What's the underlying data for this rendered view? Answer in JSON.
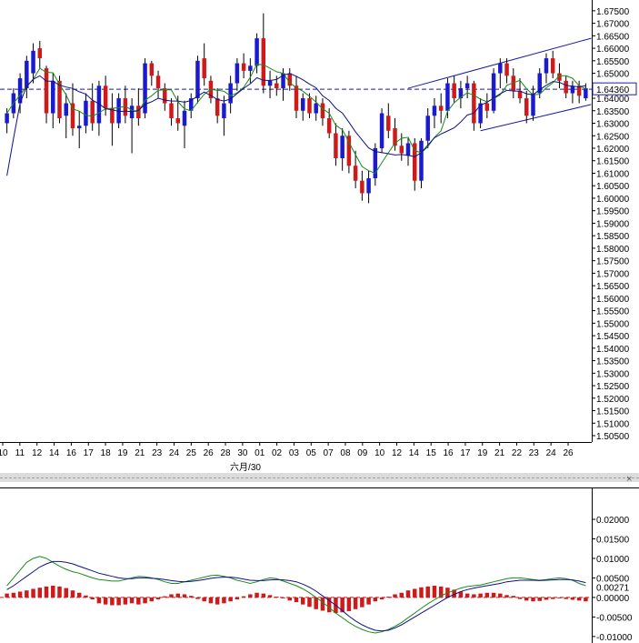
{
  "chart_data": [
    {
      "type": "candlestick",
      "title": "",
      "ylim": [
        1.505,
        1.6775
      ],
      "y_ticks": [
        "1.67500",
        "1.67000",
        "1.66500",
        "1.66000",
        "1.65500",
        "1.65000",
        "1.64500",
        "1.64000",
        "1.63500",
        "1.63000",
        "1.62500",
        "1.62000",
        "1.61500",
        "1.61000",
        "1.60500",
        "1.60000",
        "1.59500",
        "1.59000",
        "1.58500",
        "1.58000",
        "1.57500",
        "1.57000",
        "1.56500",
        "1.56000",
        "1.55500",
        "1.55000",
        "1.54500",
        "1.54000",
        "1.53500",
        "1.53000",
        "1.52500",
        "1.52000",
        "1.51500",
        "1.51000",
        "1.50500"
      ],
      "current_price_label": "1.64360",
      "current_price": 1.6436,
      "x_labels": [
        "10",
        "11",
        "12",
        "14",
        "16",
        "17",
        "18",
        "19",
        "21",
        "23",
        "24",
        "25",
        "26",
        "28",
        "30",
        "01",
        "02",
        "03",
        "05",
        "07",
        "08",
        "09",
        "10",
        "12",
        "14",
        "15",
        "16",
        "17",
        "19",
        "21",
        "22",
        "23",
        "24",
        "26"
      ],
      "x_label_month": "六月/30",
      "colors": {
        "up": "#1a1ad0",
        "down": "#d01a1a",
        "ma_fast": "#1a8a1a",
        "ma_slow": "#10108a",
        "channel": "#1a1aa8",
        "price_line": "#1a1aa8"
      },
      "candles": [
        {
          "o": 1.63,
          "h": 1.636,
          "l": 1.626,
          "c": 1.634
        },
        {
          "o": 1.634,
          "h": 1.644,
          "l": 1.632,
          "c": 1.642
        },
        {
          "o": 1.638,
          "h": 1.65,
          "l": 1.634,
          "c": 1.648
        },
        {
          "o": 1.644,
          "h": 1.657,
          "l": 1.64,
          "c": 1.655
        },
        {
          "o": 1.65,
          "h": 1.662,
          "l": 1.646,
          "c": 1.659
        },
        {
          "o": 1.66,
          "h": 1.663,
          "l": 1.652,
          "c": 1.656
        },
        {
          "o": 1.652,
          "h": 1.653,
          "l": 1.63,
          "c": 1.634
        },
        {
          "o": 1.634,
          "h": 1.65,
          "l": 1.628,
          "c": 1.647
        },
        {
          "o": 1.647,
          "h": 1.649,
          "l": 1.63,
          "c": 1.632
        },
        {
          "o": 1.633,
          "h": 1.642,
          "l": 1.624,
          "c": 1.638
        },
        {
          "o": 1.638,
          "h": 1.646,
          "l": 1.625,
          "c": 1.628
        },
        {
          "o": 1.628,
          "h": 1.635,
          "l": 1.62,
          "c": 1.629
        },
        {
          "o": 1.629,
          "h": 1.642,
          "l": 1.626,
          "c": 1.639
        },
        {
          "o": 1.639,
          "h": 1.646,
          "l": 1.627,
          "c": 1.63
        },
        {
          "o": 1.63,
          "h": 1.647,
          "l": 1.625,
          "c": 1.645
        },
        {
          "o": 1.645,
          "h": 1.649,
          "l": 1.633,
          "c": 1.636
        },
        {
          "o": 1.636,
          "h": 1.642,
          "l": 1.621,
          "c": 1.63
        },
        {
          "o": 1.63,
          "h": 1.642,
          "l": 1.628,
          "c": 1.64
        },
        {
          "o": 1.64,
          "h": 1.645,
          "l": 1.63,
          "c": 1.633
        },
        {
          "o": 1.632,
          "h": 1.64,
          "l": 1.618,
          "c": 1.637
        },
        {
          "o": 1.637,
          "h": 1.644,
          "l": 1.629,
          "c": 1.632
        },
        {
          "o": 1.634,
          "h": 1.656,
          "l": 1.632,
          "c": 1.654
        },
        {
          "o": 1.654,
          "h": 1.655,
          "l": 1.645,
          "c": 1.649
        },
        {
          "o": 1.649,
          "h": 1.651,
          "l": 1.64,
          "c": 1.644
        },
        {
          "o": 1.644,
          "h": 1.646,
          "l": 1.635,
          "c": 1.638
        },
        {
          "o": 1.638,
          "h": 1.64,
          "l": 1.629,
          "c": 1.632
        },
        {
          "o": 1.632,
          "h": 1.641,
          "l": 1.627,
          "c": 1.63
        },
        {
          "o": 1.629,
          "h": 1.639,
          "l": 1.62,
          "c": 1.635
        },
        {
          "o": 1.635,
          "h": 1.642,
          "l": 1.632,
          "c": 1.64
        },
        {
          "o": 1.64,
          "h": 1.657,
          "l": 1.638,
          "c": 1.655
        },
        {
          "o": 1.656,
          "h": 1.662,
          "l": 1.645,
          "c": 1.648
        },
        {
          "o": 1.647,
          "h": 1.649,
          "l": 1.638,
          "c": 1.64
        },
        {
          "o": 1.64,
          "h": 1.644,
          "l": 1.63,
          "c": 1.633
        },
        {
          "o": 1.632,
          "h": 1.641,
          "l": 1.625,
          "c": 1.638
        },
        {
          "o": 1.638,
          "h": 1.649,
          "l": 1.634,
          "c": 1.646
        },
        {
          "o": 1.646,
          "h": 1.656,
          "l": 1.643,
          "c": 1.654
        },
        {
          "o": 1.654,
          "h": 1.658,
          "l": 1.648,
          "c": 1.651
        },
        {
          "o": 1.651,
          "h": 1.656,
          "l": 1.646,
          "c": 1.653
        },
        {
          "o": 1.653,
          "h": 1.666,
          "l": 1.65,
          "c": 1.664
        },
        {
          "o": 1.664,
          "h": 1.674,
          "l": 1.642,
          "c": 1.645
        },
        {
          "o": 1.645,
          "h": 1.651,
          "l": 1.64,
          "c": 1.647
        },
        {
          "o": 1.646,
          "h": 1.649,
          "l": 1.641,
          "c": 1.644
        },
        {
          "o": 1.644,
          "h": 1.652,
          "l": 1.639,
          "c": 1.65
        },
        {
          "o": 1.65,
          "h": 1.652,
          "l": 1.643,
          "c": 1.645
        },
        {
          "o": 1.645,
          "h": 1.649,
          "l": 1.632,
          "c": 1.635
        },
        {
          "o": 1.635,
          "h": 1.642,
          "l": 1.631,
          "c": 1.64
        },
        {
          "o": 1.64,
          "h": 1.642,
          "l": 1.632,
          "c": 1.634
        },
        {
          "o": 1.634,
          "h": 1.641,
          "l": 1.631,
          "c": 1.638
        },
        {
          "o": 1.638,
          "h": 1.64,
          "l": 1.629,
          "c": 1.632
        },
        {
          "o": 1.632,
          "h": 1.636,
          "l": 1.624,
          "c": 1.626
        },
        {
          "o": 1.626,
          "h": 1.63,
          "l": 1.613,
          "c": 1.616
        },
        {
          "o": 1.616,
          "h": 1.628,
          "l": 1.611,
          "c": 1.625
        },
        {
          "o": 1.625,
          "h": 1.627,
          "l": 1.61,
          "c": 1.613
        },
        {
          "o": 1.613,
          "h": 1.619,
          "l": 1.604,
          "c": 1.607
        },
        {
          "o": 1.607,
          "h": 1.611,
          "l": 1.599,
          "c": 1.602
        },
        {
          "o": 1.602,
          "h": 1.611,
          "l": 1.598,
          "c": 1.608
        },
        {
          "o": 1.608,
          "h": 1.622,
          "l": 1.605,
          "c": 1.62
        },
        {
          "o": 1.62,
          "h": 1.636,
          "l": 1.618,
          "c": 1.634
        },
        {
          "o": 1.633,
          "h": 1.638,
          "l": 1.624,
          "c": 1.627
        },
        {
          "o": 1.628,
          "h": 1.632,
          "l": 1.619,
          "c": 1.621
        },
        {
          "o": 1.621,
          "h": 1.626,
          "l": 1.615,
          "c": 1.618
        },
        {
          "o": 1.617,
          "h": 1.624,
          "l": 1.613,
          "c": 1.622
        },
        {
          "o": 1.622,
          "h": 1.624,
          "l": 1.603,
          "c": 1.607
        },
        {
          "o": 1.607,
          "h": 1.624,
          "l": 1.604,
          "c": 1.623
        },
        {
          "o": 1.623,
          "h": 1.636,
          "l": 1.62,
          "c": 1.633
        },
        {
          "o": 1.633,
          "h": 1.64,
          "l": 1.628,
          "c": 1.637
        },
        {
          "o": 1.637,
          "h": 1.642,
          "l": 1.63,
          "c": 1.635
        },
        {
          "o": 1.635,
          "h": 1.648,
          "l": 1.632,
          "c": 1.646
        },
        {
          "o": 1.646,
          "h": 1.649,
          "l": 1.638,
          "c": 1.64
        },
        {
          "o": 1.64,
          "h": 1.647,
          "l": 1.636,
          "c": 1.644
        },
        {
          "o": 1.644,
          "h": 1.649,
          "l": 1.64,
          "c": 1.646
        },
        {
          "o": 1.646,
          "h": 1.647,
          "l": 1.627,
          "c": 1.63
        },
        {
          "o": 1.63,
          "h": 1.64,
          "l": 1.628,
          "c": 1.638
        },
        {
          "o": 1.638,
          "h": 1.642,
          "l": 1.632,
          "c": 1.635
        },
        {
          "o": 1.635,
          "h": 1.652,
          "l": 1.634,
          "c": 1.65
        },
        {
          "o": 1.65,
          "h": 1.656,
          "l": 1.644,
          "c": 1.654
        },
        {
          "o": 1.654,
          "h": 1.656,
          "l": 1.646,
          "c": 1.649
        },
        {
          "o": 1.649,
          "h": 1.652,
          "l": 1.64,
          "c": 1.643
        },
        {
          "o": 1.643,
          "h": 1.648,
          "l": 1.638,
          "c": 1.64
        },
        {
          "o": 1.64,
          "h": 1.643,
          "l": 1.63,
          "c": 1.633
        },
        {
          "o": 1.633,
          "h": 1.645,
          "l": 1.631,
          "c": 1.642
        },
        {
          "o": 1.642,
          "h": 1.652,
          "l": 1.64,
          "c": 1.65
        },
        {
          "o": 1.65,
          "h": 1.658,
          "l": 1.646,
          "c": 1.656
        },
        {
          "o": 1.656,
          "h": 1.659,
          "l": 1.648,
          "c": 1.65
        },
        {
          "o": 1.65,
          "h": 1.654,
          "l": 1.644,
          "c": 1.647
        },
        {
          "o": 1.647,
          "h": 1.649,
          "l": 1.64,
          "c": 1.642
        },
        {
          "o": 1.642,
          "h": 1.647,
          "l": 1.638,
          "c": 1.645
        },
        {
          "o": 1.645,
          "h": 1.647,
          "l": 1.638,
          "c": 1.641
        },
        {
          "o": 1.64,
          "h": 1.646,
          "l": 1.639,
          "c": 1.644
        }
      ],
      "trend_channel": {
        "upper": [
          {
            "index": 61,
            "price": 1.644
          },
          {
            "index": 88,
            "price": 1.664
          }
        ],
        "lower": [
          {
            "index": 72,
            "price": 1.627
          },
          {
            "index": 88,
            "price": 1.6375
          }
        ]
      }
    },
    {
      "type": "bar",
      "title": "",
      "ylim": [
        -0.0105,
        0.0235
      ],
      "y_ticks": [
        "0.02000",
        "0.01500",
        "0.01000",
        "0.00500",
        "0.00000",
        "-0.00500",
        "-0.01000"
      ],
      "current_value_label": "0.00271",
      "current_value": 0.00271,
      "histogram": [
        0.001,
        0.0012,
        0.0015,
        0.0018,
        0.0022,
        0.0025,
        0.0028,
        0.003,
        0.0028,
        0.0024,
        0.0018,
        0.0012,
        0.0005,
        -0.0005,
        -0.0015,
        -0.0018,
        -0.002,
        -0.002,
        -0.0018,
        -0.0015,
        -0.0018,
        -0.0015,
        -0.001,
        -0.0005,
        0.0003,
        0.0008,
        0.001,
        0.0008,
        0.0004,
        -0.0004,
        -0.001,
        -0.0015,
        -0.0018,
        -0.0015,
        -0.001,
        -0.0005,
        0.0003,
        0.0008,
        0.0012,
        0.001,
        0.0006,
        0.0002,
        -0.0002,
        -0.0008,
        -0.0012,
        -0.0018,
        -0.0024,
        -0.003,
        -0.0034,
        -0.0038,
        -0.004,
        -0.0038,
        -0.0035,
        -0.003,
        -0.0025,
        -0.0018,
        -0.001,
        -0.0005,
        0.0002,
        0.0008,
        0.0012,
        0.0018,
        0.0022,
        0.0026,
        0.0028,
        0.003,
        0.0028,
        0.0025,
        0.002,
        0.0015,
        0.001,
        0.0008,
        0.001,
        0.0012,
        0.0012,
        0.001,
        0.0006,
        0.0004,
        -0.0004,
        -0.0008,
        -0.001,
        -0.0009,
        -0.0006,
        -0.0004,
        -0.0002,
        -0.0004,
        -0.0006,
        -0.0008,
        -0.001
      ],
      "signal_fast": [
        0.003,
        0.005,
        0.007,
        0.009,
        0.01,
        0.0105,
        0.01,
        0.009,
        0.008,
        0.0072,
        0.0066,
        0.0062,
        0.0056,
        0.005,
        0.0046,
        0.0044,
        0.0042,
        0.0042,
        0.0046,
        0.005,
        0.0054,
        0.0053,
        0.005,
        0.0046,
        0.004,
        0.0036,
        0.0036,
        0.004,
        0.0044,
        0.0048,
        0.0052,
        0.0056,
        0.0057,
        0.0054,
        0.005,
        0.0044,
        0.004,
        0.0036,
        0.004,
        0.0046,
        0.005,
        0.0048,
        0.0042,
        0.0036,
        0.003,
        0.0022,
        0.0012,
        0.0,
        -0.0012,
        -0.0026,
        -0.004,
        -0.0052,
        -0.0064,
        -0.0074,
        -0.0082,
        -0.0088,
        -0.0091,
        -0.0088,
        -0.0082,
        -0.0074,
        -0.0064,
        -0.0052,
        -0.004,
        -0.0028,
        -0.0016,
        -0.0006,
        0.0004,
        0.0012,
        0.0018,
        0.0024,
        0.0028,
        0.003,
        0.0032,
        0.0036,
        0.004,
        0.0044,
        0.0048,
        0.005,
        0.005,
        0.0048,
        0.0046,
        0.0044,
        0.0046,
        0.0048,
        0.005,
        0.0048,
        0.0044,
        0.0036,
        0.003
      ],
      "signal_slow": [
        0.002,
        0.003,
        0.0042,
        0.0054,
        0.0066,
        0.0078,
        0.0086,
        0.0092,
        0.0092,
        0.009,
        0.0086,
        0.008,
        0.0074,
        0.0068,
        0.0062,
        0.0058,
        0.0054,
        0.005,
        0.0048,
        0.0048,
        0.005,
        0.005,
        0.0049,
        0.0048,
        0.0046,
        0.0043,
        0.0041,
        0.004,
        0.0041,
        0.0043,
        0.0046,
        0.0049,
        0.0051,
        0.0052,
        0.0052,
        0.005,
        0.0047,
        0.0044,
        0.0043,
        0.0043,
        0.0045,
        0.0046,
        0.0045,
        0.0043,
        0.004,
        0.0034,
        0.0026,
        0.0016,
        0.0004,
        -0.0008,
        -0.002,
        -0.0034,
        -0.0048,
        -0.006,
        -0.007,
        -0.0078,
        -0.0084,
        -0.0086,
        -0.0084,
        -0.0078,
        -0.007,
        -0.006,
        -0.005,
        -0.004,
        -0.003,
        -0.002,
        -0.001,
        0.0,
        0.0008,
        0.0015,
        0.002,
        0.0024,
        0.0027,
        0.003,
        0.0033,
        0.0036,
        0.004,
        0.0042,
        0.0044,
        0.0044,
        0.0044,
        0.0043,
        0.0044,
        0.0045,
        0.0046,
        0.0046,
        0.0045,
        0.0042,
        0.0038
      ],
      "colors": {
        "histogram": "#d01a1a",
        "signal_fast": "#1a8a1a",
        "signal_slow": "#10108a",
        "zero_line": "#d01a1a"
      }
    }
  ],
  "window": {
    "pane_close_glyph": "×",
    "pane_close_icon": "close-icon"
  }
}
